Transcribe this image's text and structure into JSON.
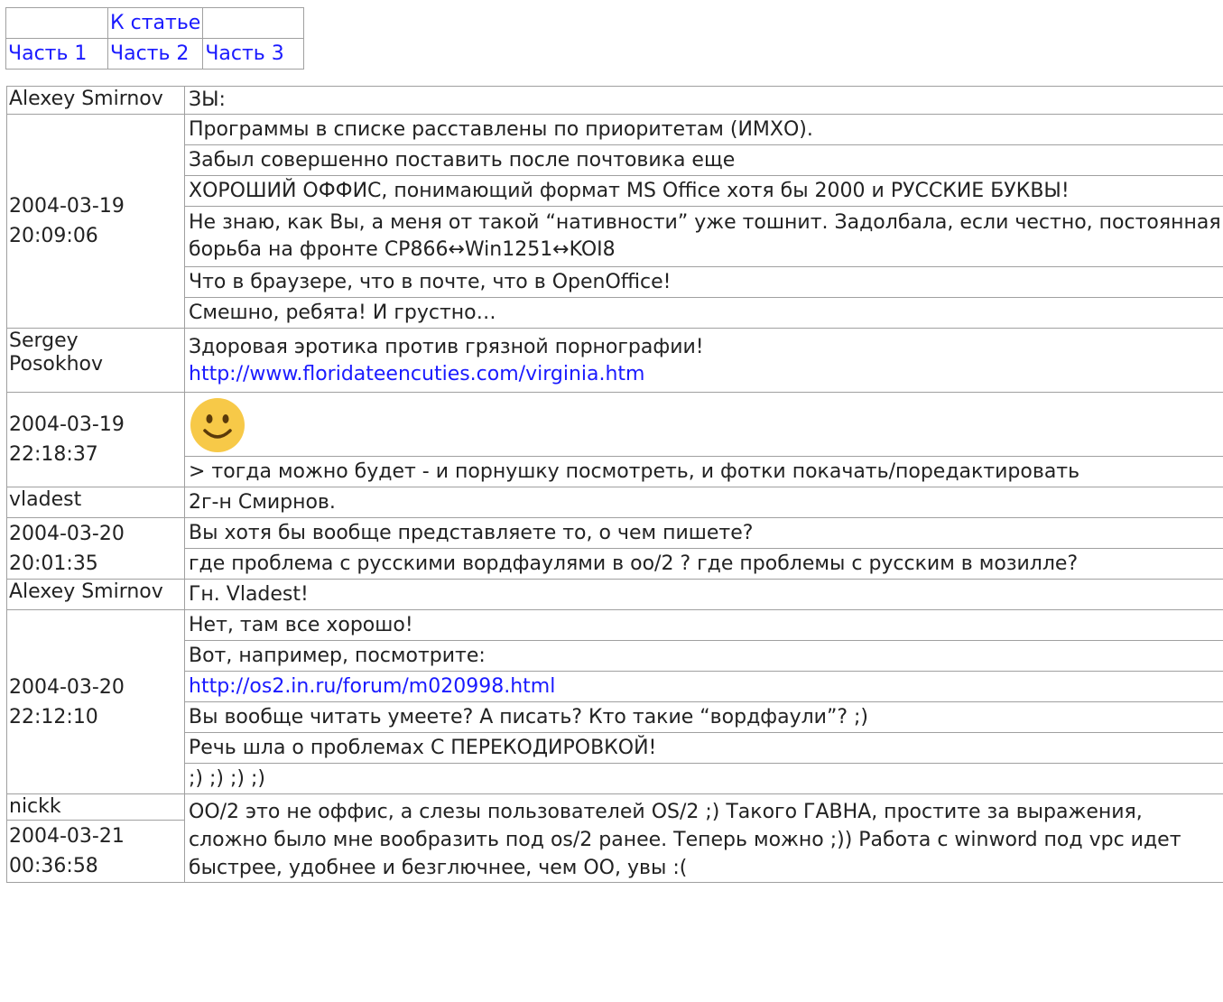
{
  "nav": {
    "article_link": "К статье",
    "part1": "Часть 1",
    "part2": "Часть 2",
    "part3": "Часть 3"
  },
  "comments": [
    {
      "author": "Alexey Smirnov",
      "date": "2004-03-19 20:09:06",
      "lines": [
        "ЗЫ:",
        "Программы в списке расставлены по приоритетам (ИМХО).",
        "Забыл совершенно поставить после почтовика еще",
        "ХОРОШИЙ ОФФИС, понимающий формат MS Office хотя бы 2000 и РУССКИЕ БУКВЫ!",
        "Не знаю, как Вы, а меня от такой “нативности” уже тошнит. Задолбала, если честно, постоянная борьба на фронте CP866↔Win1251↔KOI8",
        "Что в браузере, что в почте, что в OpenOffice!",
        "Смешно, ребята! И грустно…"
      ]
    },
    {
      "author": "Sergey Posokhov",
      "date": "2004-03-19 22:18:37",
      "lines": [
        "Здоровая эротика против грязной порнографии!",
        "http://www.floridateencuties.com/virginia.htm",
        "> тогда можно будет - и порнушку посмотреть, и фотки покачать/поредактировать"
      ],
      "smiley_icon": "smiley-face-icon"
    },
    {
      "author": "vladest",
      "date": "2004-03-20 20:01:35",
      "lines": [
        "2г-н Смирнов.",
        "Вы хотя бы вообще представляете то, о чем пишете?",
        "где проблема с русскими вордфаулями в оо/2 ? где проблемы с русским в мозилле?"
      ]
    },
    {
      "author": "Alexey Smirnov",
      "date": "2004-03-20 22:12:10",
      "lines": [
        "Гн. Vladest!",
        "Нет, там все хорошо!",
        "Вот, например, посмотрите:",
        "http://os2.in.ru/forum/m020998.html",
        "Вы вообще читать умеете? А писать? Кто такие “вордфаули”? ;)",
        "Речь шла о проблемах С ПЕРЕКОДИРОВКОЙ!",
        ";) ;) ;) ;)"
      ]
    },
    {
      "author": "nickk",
      "date": "2004-03-21 00:36:58",
      "lines": [
        "ОО/2 это не оффис, а слезы пользователей OS/2 ;) Такого ГАВНА, простите за выражения, сложно было мне вообразить под os/2 ранее. Теперь можно ;)) Работа с winword под vpc идет быстрее, удобнее и безглючнее, чем ОО, увы :("
      ]
    }
  ],
  "colors": {
    "link": "#1a1aff",
    "border": "#a0a0a0",
    "text": "#222222"
  }
}
